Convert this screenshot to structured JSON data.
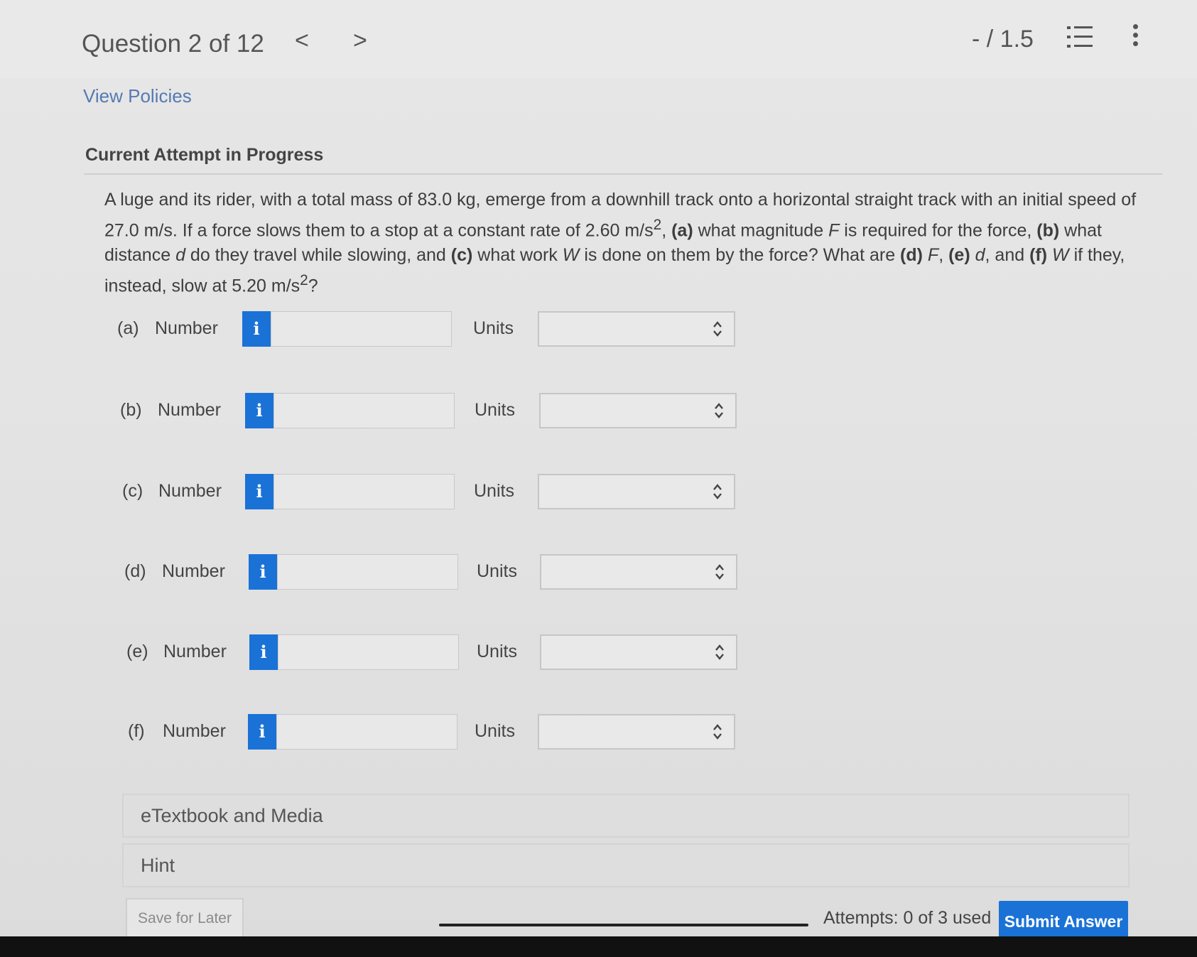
{
  "header": {
    "question_title": "Question 2 of 12",
    "prev_glyph": "<",
    "next_glyph": ">",
    "score": "- / 1.5",
    "list_icon": "list-icon",
    "more_icon": "more-vertical-icon"
  },
  "view_policies": "View Policies",
  "attempt_title": "Current Attempt in Progress",
  "question": {
    "t1": "A luge and its rider, with a total mass of 83.0 kg, emerge from a downhill track onto a horizontal straight track with an initial speed of 27.0 m/s. If a force slows them to a stop at a constant rate of 2.60 m/s",
    "sup1": "2",
    "t2": ", ",
    "a": "(a)",
    "t3": " what magnitude ",
    "F1": "F",
    "t4": " is required for the force, ",
    "b": "(b)",
    "t5": " what distance ",
    "d1": "d",
    "t6": " do they travel while slowing, and ",
    "c": "(c)",
    "t7": " what work ",
    "W1": "W",
    "t8": " is done on them by the force? What are ",
    "dd": "(d)",
    "t9": " ",
    "F2": "F",
    "t10": ", ",
    "e": "(e)",
    "t11": " ",
    "d2": "d",
    "t12": ", and ",
    "f": "(f)",
    "t13": " ",
    "W2": "W",
    "t14": " if they, instead, slow at 5.20 m/s",
    "sup2": "2",
    "t15": "?"
  },
  "parts": [
    {
      "label": "(a)",
      "number_label": "Number",
      "info": "i",
      "value": "",
      "units_label": "Units",
      "units_value": ""
    },
    {
      "label": "(b)",
      "number_label": "Number",
      "info": "i",
      "value": "",
      "units_label": "Units",
      "units_value": ""
    },
    {
      "label": "(c)",
      "number_label": "Number",
      "info": "i",
      "value": "",
      "units_label": "Units",
      "units_value": ""
    },
    {
      "label": "(d)",
      "number_label": "Number",
      "info": "i",
      "value": "",
      "units_label": "Units",
      "units_value": ""
    },
    {
      "label": "(e)",
      "number_label": "Number",
      "info": "i",
      "value": "",
      "units_label": "Units",
      "units_value": ""
    },
    {
      "label": "(f)",
      "number_label": "Number",
      "info": "i",
      "value": "",
      "units_label": "Units",
      "units_value": ""
    }
  ],
  "etextbook": "eTextbook and Media",
  "hint": "Hint",
  "save_later": "Save for Later",
  "attempts": "Attempts: 0 of 3 used",
  "submit": "Submit Answer",
  "colors": {
    "accent": "#1a72d6",
    "link": "#557ab3"
  }
}
